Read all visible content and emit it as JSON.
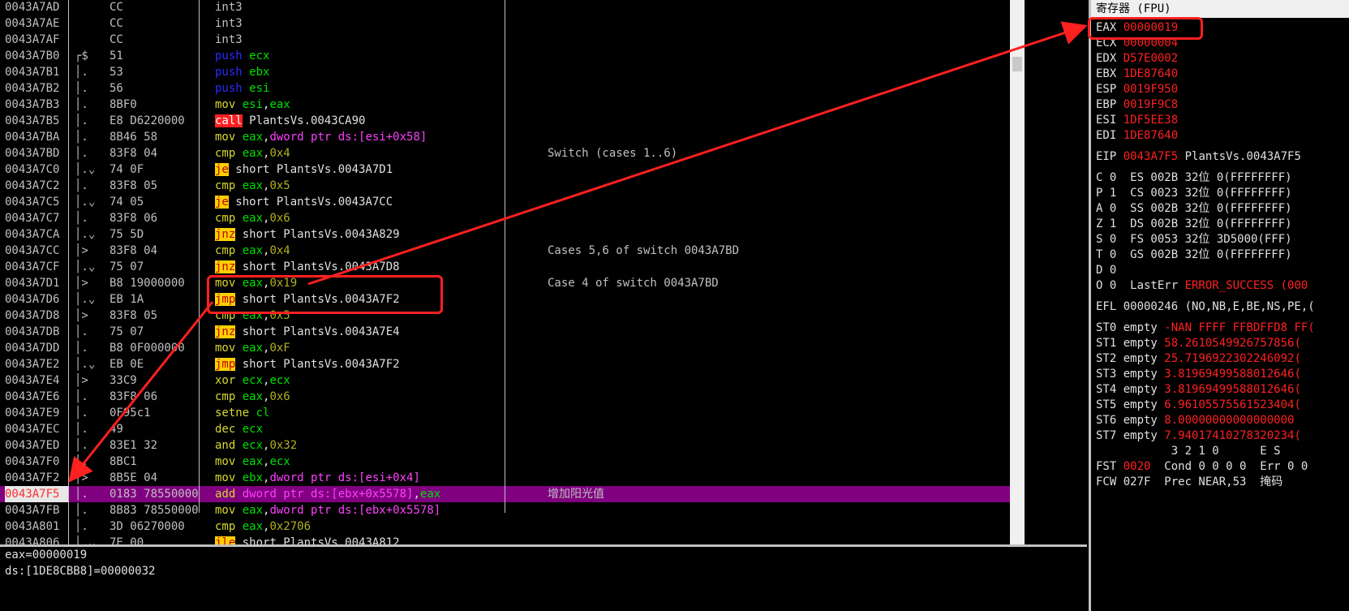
{
  "disasm": {
    "rows": [
      {
        "addr": "0043A7AD",
        "arrow": "",
        "bytes": "CC",
        "instr": [
          {
            "t": "int3",
            "c": "mn"
          }
        ],
        "comment": ""
      },
      {
        "addr": "0043A7AE",
        "arrow": "",
        "bytes": "CC",
        "instr": [
          {
            "t": "int3",
            "c": "mn"
          }
        ],
        "comment": ""
      },
      {
        "addr": "0043A7AF",
        "arrow": "",
        "bytes": "CC",
        "instr": [
          {
            "t": "int3",
            "c": "mn"
          }
        ],
        "comment": ""
      },
      {
        "addr": "0043A7B0",
        "arrow": "┌$",
        "bytes": "51",
        "instr": [
          {
            "t": "push",
            "c": "kw-blue"
          },
          {
            "t": " ecx",
            "c": "reg"
          }
        ],
        "comment": ""
      },
      {
        "addr": "0043A7B1",
        "arrow": "│.",
        "bytes": "53",
        "instr": [
          {
            "t": "push",
            "c": "kw-blue"
          },
          {
            "t": " ebx",
            "c": "reg"
          }
        ],
        "comment": ""
      },
      {
        "addr": "0043A7B2",
        "arrow": "│.",
        "bytes": "56",
        "instr": [
          {
            "t": "push",
            "c": "kw-blue"
          },
          {
            "t": " esi",
            "c": "reg"
          }
        ],
        "comment": ""
      },
      {
        "addr": "0043A7B3",
        "arrow": "│.",
        "bytes": "8BF0",
        "instr": [
          {
            "t": "mov",
            "c": "kw-olive"
          },
          {
            "t": " esi",
            "c": "reg"
          },
          {
            "t": ",",
            "c": "txt"
          },
          {
            "t": "eax",
            "c": "reg"
          }
        ],
        "comment": ""
      },
      {
        "addr": "0043A7B5",
        "arrow": "│.",
        "bytes": "E8 D6220000",
        "instr": [
          {
            "t": "call",
            "c": "box-red"
          },
          {
            "t": " PlantsVs.0043CA90",
            "c": "txt"
          }
        ],
        "comment": ""
      },
      {
        "addr": "0043A7BA",
        "arrow": "│.",
        "bytes": "8B46 58",
        "instr": [
          {
            "t": "mov",
            "c": "kw-olive"
          },
          {
            "t": " eax",
            "c": "reg"
          },
          {
            "t": ",",
            "c": "txt"
          },
          {
            "t": "dword ptr ds:[esi+0x58]",
            "c": "mem"
          }
        ],
        "comment": ""
      },
      {
        "addr": "0043A7BD",
        "arrow": "│.",
        "bytes": "83F8 04",
        "instr": [
          {
            "t": "cmp",
            "c": "kw-olive"
          },
          {
            "t": " eax",
            "c": "reg"
          },
          {
            "t": ",",
            "c": "txt"
          },
          {
            "t": "0x4",
            "c": "imm"
          }
        ],
        "comment": "Switch (cases 1..6)"
      },
      {
        "addr": "0043A7C0",
        "arrow": "│.⌄",
        "bytes": "74 0F",
        "instr": [
          {
            "t": "je",
            "c": "box-yel"
          },
          {
            "t": " short PlantsVs.0043A7D1",
            "c": "txt"
          }
        ],
        "comment": ""
      },
      {
        "addr": "0043A7C2",
        "arrow": "│.",
        "bytes": "83F8 05",
        "instr": [
          {
            "t": "cmp",
            "c": "kw-olive"
          },
          {
            "t": " eax",
            "c": "reg"
          },
          {
            "t": ",",
            "c": "txt"
          },
          {
            "t": "0x5",
            "c": "imm"
          }
        ],
        "comment": ""
      },
      {
        "addr": "0043A7C5",
        "arrow": "│.⌄",
        "bytes": "74 05",
        "instr": [
          {
            "t": "je",
            "c": "box-yel"
          },
          {
            "t": " short PlantsVs.0043A7CC",
            "c": "txt"
          }
        ],
        "comment": ""
      },
      {
        "addr": "0043A7C7",
        "arrow": "│.",
        "bytes": "83F8 06",
        "instr": [
          {
            "t": "cmp",
            "c": "kw-olive"
          },
          {
            "t": " eax",
            "c": "reg"
          },
          {
            "t": ",",
            "c": "txt"
          },
          {
            "t": "0x6",
            "c": "imm"
          }
        ],
        "comment": ""
      },
      {
        "addr": "0043A7CA",
        "arrow": "│.⌄",
        "bytes": "75 5D",
        "instr": [
          {
            "t": "jnz",
            "c": "box-yel"
          },
          {
            "t": " short PlantsVs.0043A829",
            "c": "txt"
          }
        ],
        "comment": ""
      },
      {
        "addr": "0043A7CC",
        "arrow": "│>",
        "bytes": "83F8 04",
        "instr": [
          {
            "t": "cmp",
            "c": "kw-olive"
          },
          {
            "t": " eax",
            "c": "reg"
          },
          {
            "t": ",",
            "c": "txt"
          },
          {
            "t": "0x4",
            "c": "imm"
          }
        ],
        "comment": "Cases 5,6 of switch 0043A7BD"
      },
      {
        "addr": "0043A7CF",
        "arrow": "│.⌄",
        "bytes": "75 07",
        "instr": [
          {
            "t": "jnz",
            "c": "box-yel"
          },
          {
            "t": " short PlantsVs.0043A7D8",
            "c": "txt"
          }
        ],
        "comment": ""
      },
      {
        "addr": "0043A7D1",
        "arrow": "│>",
        "bytes": "B8 19000000",
        "instr": [
          {
            "t": "mov",
            "c": "kw-olive"
          },
          {
            "t": " eax",
            "c": "reg"
          },
          {
            "t": ",",
            "c": "txt"
          },
          {
            "t": "0x19",
            "c": "imm"
          }
        ],
        "comment": "Case 4 of switch 0043A7BD"
      },
      {
        "addr": "0043A7D6",
        "arrow": "│.⌄",
        "bytes": "EB 1A",
        "instr": [
          {
            "t": "jmp",
            "c": "box-yel"
          },
          {
            "t": " short PlantsVs.0043A7F2",
            "c": "txt"
          }
        ],
        "comment": ""
      },
      {
        "addr": "0043A7D8",
        "arrow": "│>",
        "bytes": "83F8 05",
        "instr": [
          {
            "t": "cmp",
            "c": "kw-olive"
          },
          {
            "t": " eax",
            "c": "reg"
          },
          {
            "t": ",",
            "c": "txt"
          },
          {
            "t": "0x5",
            "c": "imm"
          }
        ],
        "comment": ""
      },
      {
        "addr": "0043A7DB",
        "arrow": "│.",
        "bytes": "75 07",
        "instr": [
          {
            "t": "jnz",
            "c": "box-yel"
          },
          {
            "t": " short PlantsVs.0043A7E4",
            "c": "txt"
          }
        ],
        "comment": ""
      },
      {
        "addr": "0043A7DD",
        "arrow": "│.",
        "bytes": "B8 0F000000",
        "instr": [
          {
            "t": "mov",
            "c": "kw-olive"
          },
          {
            "t": " eax",
            "c": "reg"
          },
          {
            "t": ",",
            "c": "txt"
          },
          {
            "t": "0xF",
            "c": "imm"
          }
        ],
        "comment": ""
      },
      {
        "addr": "0043A7E2",
        "arrow": "│.⌄",
        "bytes": "EB 0E",
        "instr": [
          {
            "t": "jmp",
            "c": "box-yel"
          },
          {
            "t": " short PlantsVs.0043A7F2",
            "c": "txt"
          }
        ],
        "comment": ""
      },
      {
        "addr": "0043A7E4",
        "arrow": "│>",
        "bytes": "33C9",
        "instr": [
          {
            "t": "xor",
            "c": "kw-olive"
          },
          {
            "t": " ecx",
            "c": "reg"
          },
          {
            "t": ",",
            "c": "txt"
          },
          {
            "t": "ecx",
            "c": "reg"
          }
        ],
        "comment": ""
      },
      {
        "addr": "0043A7E6",
        "arrow": "│.",
        "bytes": "83F8 06",
        "instr": [
          {
            "t": "cmp",
            "c": "kw-olive"
          },
          {
            "t": " eax",
            "c": "reg"
          },
          {
            "t": ",",
            "c": "txt"
          },
          {
            "t": "0x6",
            "c": "imm"
          }
        ],
        "comment": ""
      },
      {
        "addr": "0043A7E9",
        "arrow": "│.",
        "bytes": "0F95c1",
        "instr": [
          {
            "t": "setne",
            "c": "kw-olive"
          },
          {
            "t": " cl",
            "c": "reg"
          }
        ],
        "comment": ""
      },
      {
        "addr": "0043A7EC",
        "arrow": "│.",
        "bytes": "49",
        "instr": [
          {
            "t": "dec",
            "c": "kw-olive"
          },
          {
            "t": " ecx",
            "c": "reg"
          }
        ],
        "comment": ""
      },
      {
        "addr": "0043A7ED",
        "arrow": "│.",
        "bytes": "83E1 32",
        "instr": [
          {
            "t": "and",
            "c": "kw-olive"
          },
          {
            "t": " ecx",
            "c": "reg"
          },
          {
            "t": ",",
            "c": "txt"
          },
          {
            "t": "0x32",
            "c": "imm"
          }
        ],
        "comment": ""
      },
      {
        "addr": "0043A7F0",
        "arrow": "│.",
        "bytes": "8BC1",
        "instr": [
          {
            "t": "mov",
            "c": "kw-olive"
          },
          {
            "t": " eax",
            "c": "reg"
          },
          {
            "t": ",",
            "c": "txt"
          },
          {
            "t": "ecx",
            "c": "reg"
          }
        ],
        "comment": ""
      },
      {
        "addr": "0043A7F2",
        "arrow": "│>",
        "bytes": "8B5E 04",
        "instr": [
          {
            "t": "mov",
            "c": "kw-olive"
          },
          {
            "t": " ebx",
            "c": "reg"
          },
          {
            "t": ",",
            "c": "txt"
          },
          {
            "t": "dword ptr ds:[esi+0x4]",
            "c": "mem"
          }
        ],
        "comment": ""
      },
      {
        "addr": "0043A7F5",
        "arrow": "│.",
        "bytes": "0183 78550000",
        "instr": [
          {
            "t": "add",
            "c": "kw-olive"
          },
          {
            "t": " dword ptr ds:[ebx+0x5578]",
            "c": "mem"
          },
          {
            "t": ",",
            "c": "txt"
          },
          {
            "t": "eax",
            "c": "reg"
          }
        ],
        "comment": "增加阳光值",
        "highlight": true
      },
      {
        "addr": "0043A7FB",
        "arrow": "│.",
        "bytes": "8B83 78550000",
        "instr": [
          {
            "t": "mov",
            "c": "kw-olive"
          },
          {
            "t": " eax",
            "c": "reg"
          },
          {
            "t": ",",
            "c": "txt"
          },
          {
            "t": "dword ptr ds:[ebx+0x5578]",
            "c": "mem"
          }
        ],
        "comment": ""
      },
      {
        "addr": "0043A801",
        "arrow": "│.",
        "bytes": "3D 06270000",
        "instr": [
          {
            "t": "cmp",
            "c": "kw-olive"
          },
          {
            "t": " eax",
            "c": "reg"
          },
          {
            "t": ",",
            "c": "txt"
          },
          {
            "t": "0x2706",
            "c": "imm"
          }
        ],
        "comment": ""
      },
      {
        "addr": "0043A806",
        "arrow": "│.⌄",
        "bytes": "7E 00",
        "instr": [
          {
            "t": "jle",
            "c": "box-yel"
          },
          {
            "t": " short PlantsVs.0043A812",
            "c": "txt"
          }
        ],
        "comment": ""
      }
    ]
  },
  "info": {
    "line1": "eax=00000019",
    "line2": "ds:[1DE8CBB8]=00000032"
  },
  "registers": {
    "title": "寄存器 (FPU)",
    "general": [
      {
        "name": "EAX",
        "value": "00000019"
      },
      {
        "name": "ECX",
        "value": "00000004"
      },
      {
        "name": "EDX",
        "value": "D57E0002"
      },
      {
        "name": "EBX",
        "value": "1DE87640"
      },
      {
        "name": "ESP",
        "value": "0019F950"
      },
      {
        "name": "EBP",
        "value": "0019F9C8"
      },
      {
        "name": "ESI",
        "value": "1DF5EE38"
      },
      {
        "name": "EDI",
        "value": "1DE87640"
      }
    ],
    "eip": {
      "name": "EIP",
      "value": "0043A7F5",
      "extra": "PlantsVs.0043A7F5"
    },
    "flags": [
      "C 0  ES 002B 32位 0(FFFFFFFF)",
      "P 1  CS 0023 32位 0(FFFFFFFF)",
      "A 0  SS 002B 32位 0(FFFFFFFF)",
      "Z 1  DS 002B 32位 0(FFFFFFFF)",
      "S 0  FS 0053 32位 3D5000(FFF)",
      "T 0  GS 002B 32位 0(FFFFFFFF)",
      "D 0"
    ],
    "lasterr": {
      "prefix": "O 0  LastErr ",
      "value": "ERROR_SUCCESS (000"
    },
    "efl": "EFL 00000246 (NO,NB,E,BE,NS,PE,(",
    "st": [
      {
        "name": "ST0 empty",
        "value": "-NAN FFFF FFBDFFD8 FF("
      },
      {
        "name": "ST1 empty",
        "value": "58.2610549926757856("
      },
      {
        "name": "ST2 empty",
        "value": "25.7196922302246092("
      },
      {
        "name": "ST3 empty",
        "value": "3.81969499588012646("
      },
      {
        "name": "ST4 empty",
        "value": "3.81969499588012646("
      },
      {
        "name": "ST5 empty",
        "value": "6.96105575561523404("
      },
      {
        "name": "ST6 empty",
        "value": "8.00000000000000000"
      },
      {
        "name": "ST7 empty",
        "value": "7.94017410278320234("
      }
    ],
    "st_header": "           3 2 1 0      E S",
    "fst": {
      "prefix": "FST ",
      "value": "0020",
      "rest": "  Cond 0 0 0 0  Err 0 0"
    },
    "fcw": "FCW 027F  Prec NEAR,53  掩码"
  },
  "colors": {
    "annotation": "#ff2020",
    "highlight_row": "#800080"
  }
}
